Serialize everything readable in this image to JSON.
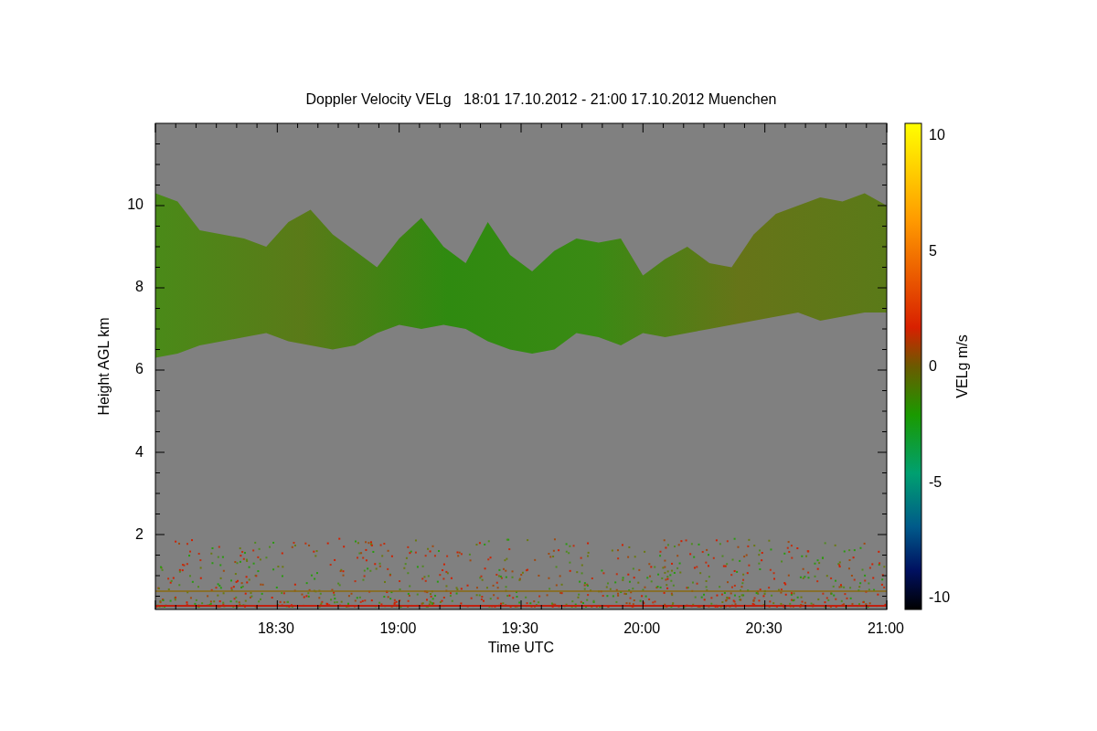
{
  "title": "Doppler Velocity VELg   18:01 17.10.2012 - 21:00 17.10.2012 Muenchen",
  "y_axis": {
    "label": "Height AGL km",
    "ticks": [
      "10",
      "8",
      "6",
      "4",
      "2"
    ]
  },
  "x_axis": {
    "label": "Time UTC",
    "ticks": [
      "18:30",
      "19:00",
      "19:30",
      "20:00",
      "20:30",
      "21:00"
    ]
  },
  "colorbar": {
    "label": "VELg m/s",
    "ticks": [
      "10",
      "5",
      "0",
      "-5",
      "-10"
    ]
  }
}
